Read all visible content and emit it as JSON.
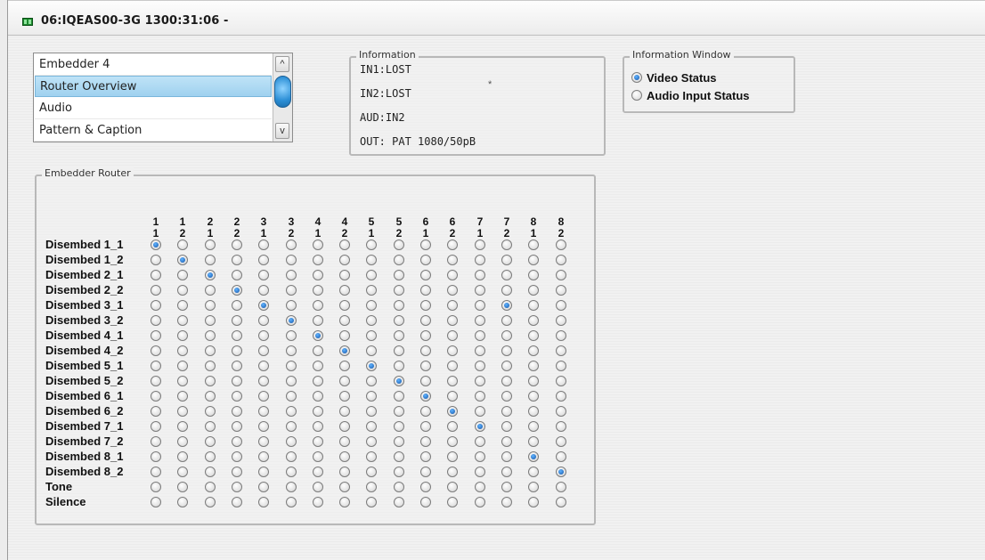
{
  "window": {
    "title": "06:IQEAS00-3G  1300:31:06  -"
  },
  "nav_list": {
    "items": [
      "Embedder 4",
      "Router Overview",
      "Audio",
      "Pattern & Caption"
    ],
    "selected_index": 1,
    "scroll_up": "^",
    "scroll_down": "v"
  },
  "information": {
    "legend": "Information",
    "lines": [
      "IN1:LOST",
      "IN2:LOST",
      "AUD:IN2",
      "OUT: PAT 1080/50pB"
    ],
    "marker": "*"
  },
  "information_window": {
    "legend": "Information Window",
    "options": [
      "Video Status",
      "Audio Input Status"
    ],
    "selected_index": 0
  },
  "router": {
    "legend": "Embedder Router",
    "columns": [
      {
        "top": "1",
        "bottom": "1"
      },
      {
        "top": "1",
        "bottom": "2"
      },
      {
        "top": "2",
        "bottom": "1"
      },
      {
        "top": "2",
        "bottom": "2"
      },
      {
        "top": "3",
        "bottom": "1"
      },
      {
        "top": "3",
        "bottom": "2"
      },
      {
        "top": "4",
        "bottom": "1"
      },
      {
        "top": "4",
        "bottom": "2"
      },
      {
        "top": "5",
        "bottom": "1"
      },
      {
        "top": "5",
        "bottom": "2"
      },
      {
        "top": "6",
        "bottom": "1"
      },
      {
        "top": "6",
        "bottom": "2"
      },
      {
        "top": "7",
        "bottom": "1"
      },
      {
        "top": "7",
        "bottom": "2"
      },
      {
        "top": "8",
        "bottom": "1"
      },
      {
        "top": "8",
        "bottom": "2"
      }
    ],
    "rows": [
      "Disembed 1_1",
      "Disembed 1_2",
      "Disembed 2_1",
      "Disembed 2_2",
      "Disembed 3_1",
      "Disembed 3_2",
      "Disembed 4_1",
      "Disembed 4_2",
      "Disembed 5_1",
      "Disembed 5_2",
      "Disembed 6_1",
      "Disembed 6_2",
      "Disembed 7_1",
      "Disembed 7_2",
      "Disembed 8_1",
      "Disembed 8_2",
      "Tone",
      "Silence"
    ],
    "selected": [
      [
        0,
        0
      ],
      [
        1,
        1
      ],
      [
        2,
        2
      ],
      [
        3,
        3
      ],
      [
        4,
        4
      ],
      [
        4,
        13
      ],
      [
        5,
        5
      ],
      [
        6,
        6
      ],
      [
        7,
        7
      ],
      [
        8,
        8
      ],
      [
        9,
        9
      ],
      [
        10,
        10
      ],
      [
        11,
        11
      ],
      [
        12,
        12
      ],
      [
        14,
        14
      ],
      [
        15,
        15
      ]
    ]
  },
  "colors": {
    "accent": "#1455a8",
    "selection": "#a9d8f3"
  }
}
